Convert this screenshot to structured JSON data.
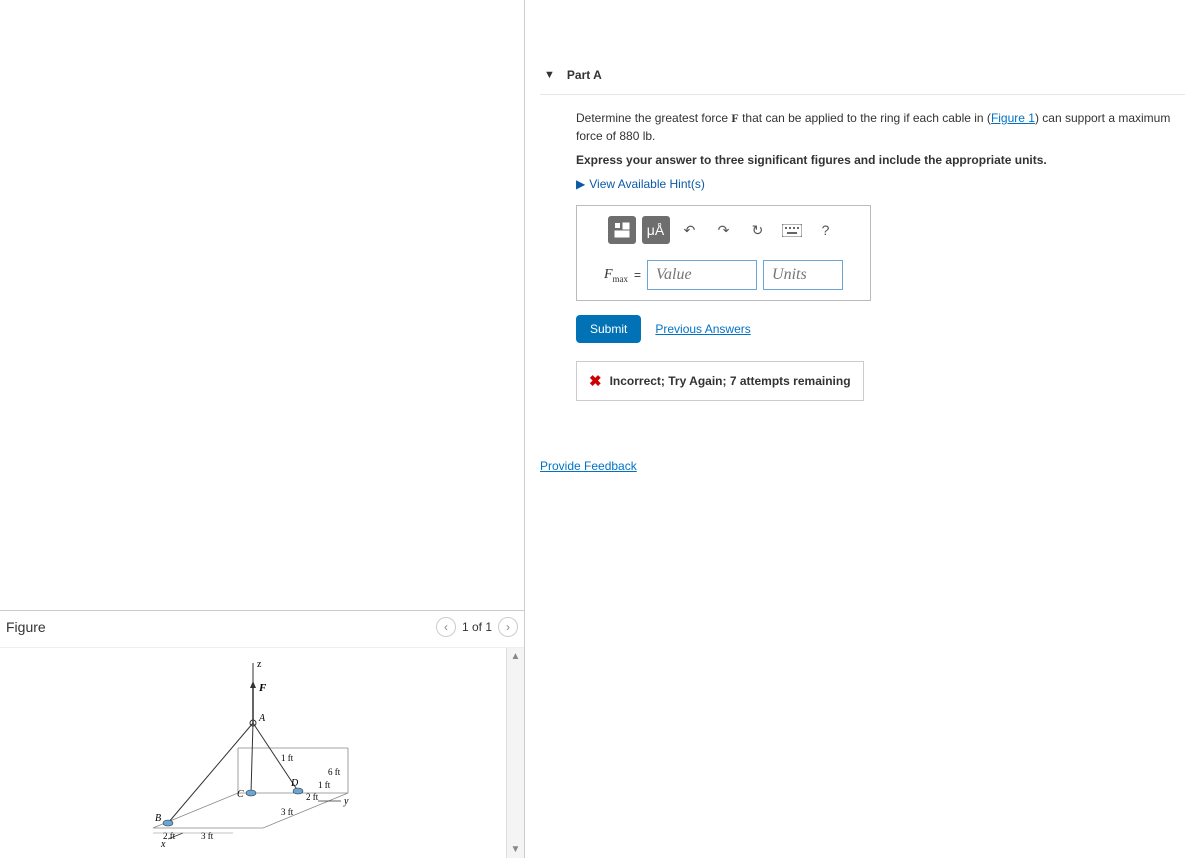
{
  "part": {
    "label": "Part A",
    "prompt_pre": "Determine the greatest force ",
    "prompt_bold": "F",
    "prompt_mid": " that can be applied to the ring if each cable in (",
    "figlink": "Figure 1",
    "prompt_post": ") can support a maximum force of 880 lb.",
    "instruction": "Express your answer to three significant figures and include the appropriate units.",
    "hints": "View Available Hint(s)"
  },
  "toolbar": {
    "ua": "μÅ",
    "help": "?"
  },
  "answer": {
    "var_html": "F",
    "var_sub": "max",
    "eq": " = ",
    "value_ph": "Value",
    "units_ph": "Units"
  },
  "actions": {
    "submit": "Submit",
    "previous": "Previous Answers"
  },
  "feedback": {
    "msg": "Incorrect; Try Again; 7 attempts remaining"
  },
  "provide": "Provide Feedback",
  "figure": {
    "title": "Figure",
    "pager": "1 of 1",
    "labels": {
      "z": "z",
      "F": "F",
      "A": "A",
      "B": "B",
      "C": "C",
      "D": "D",
      "x": "x",
      "y": "y",
      "d1": "1 ft",
      "d6": "6 ft",
      "d1b": "1 ft",
      "d2": "2 ft",
      "d3": "3 ft",
      "d2b": "2 ft",
      "d3b": "3 ft"
    }
  }
}
